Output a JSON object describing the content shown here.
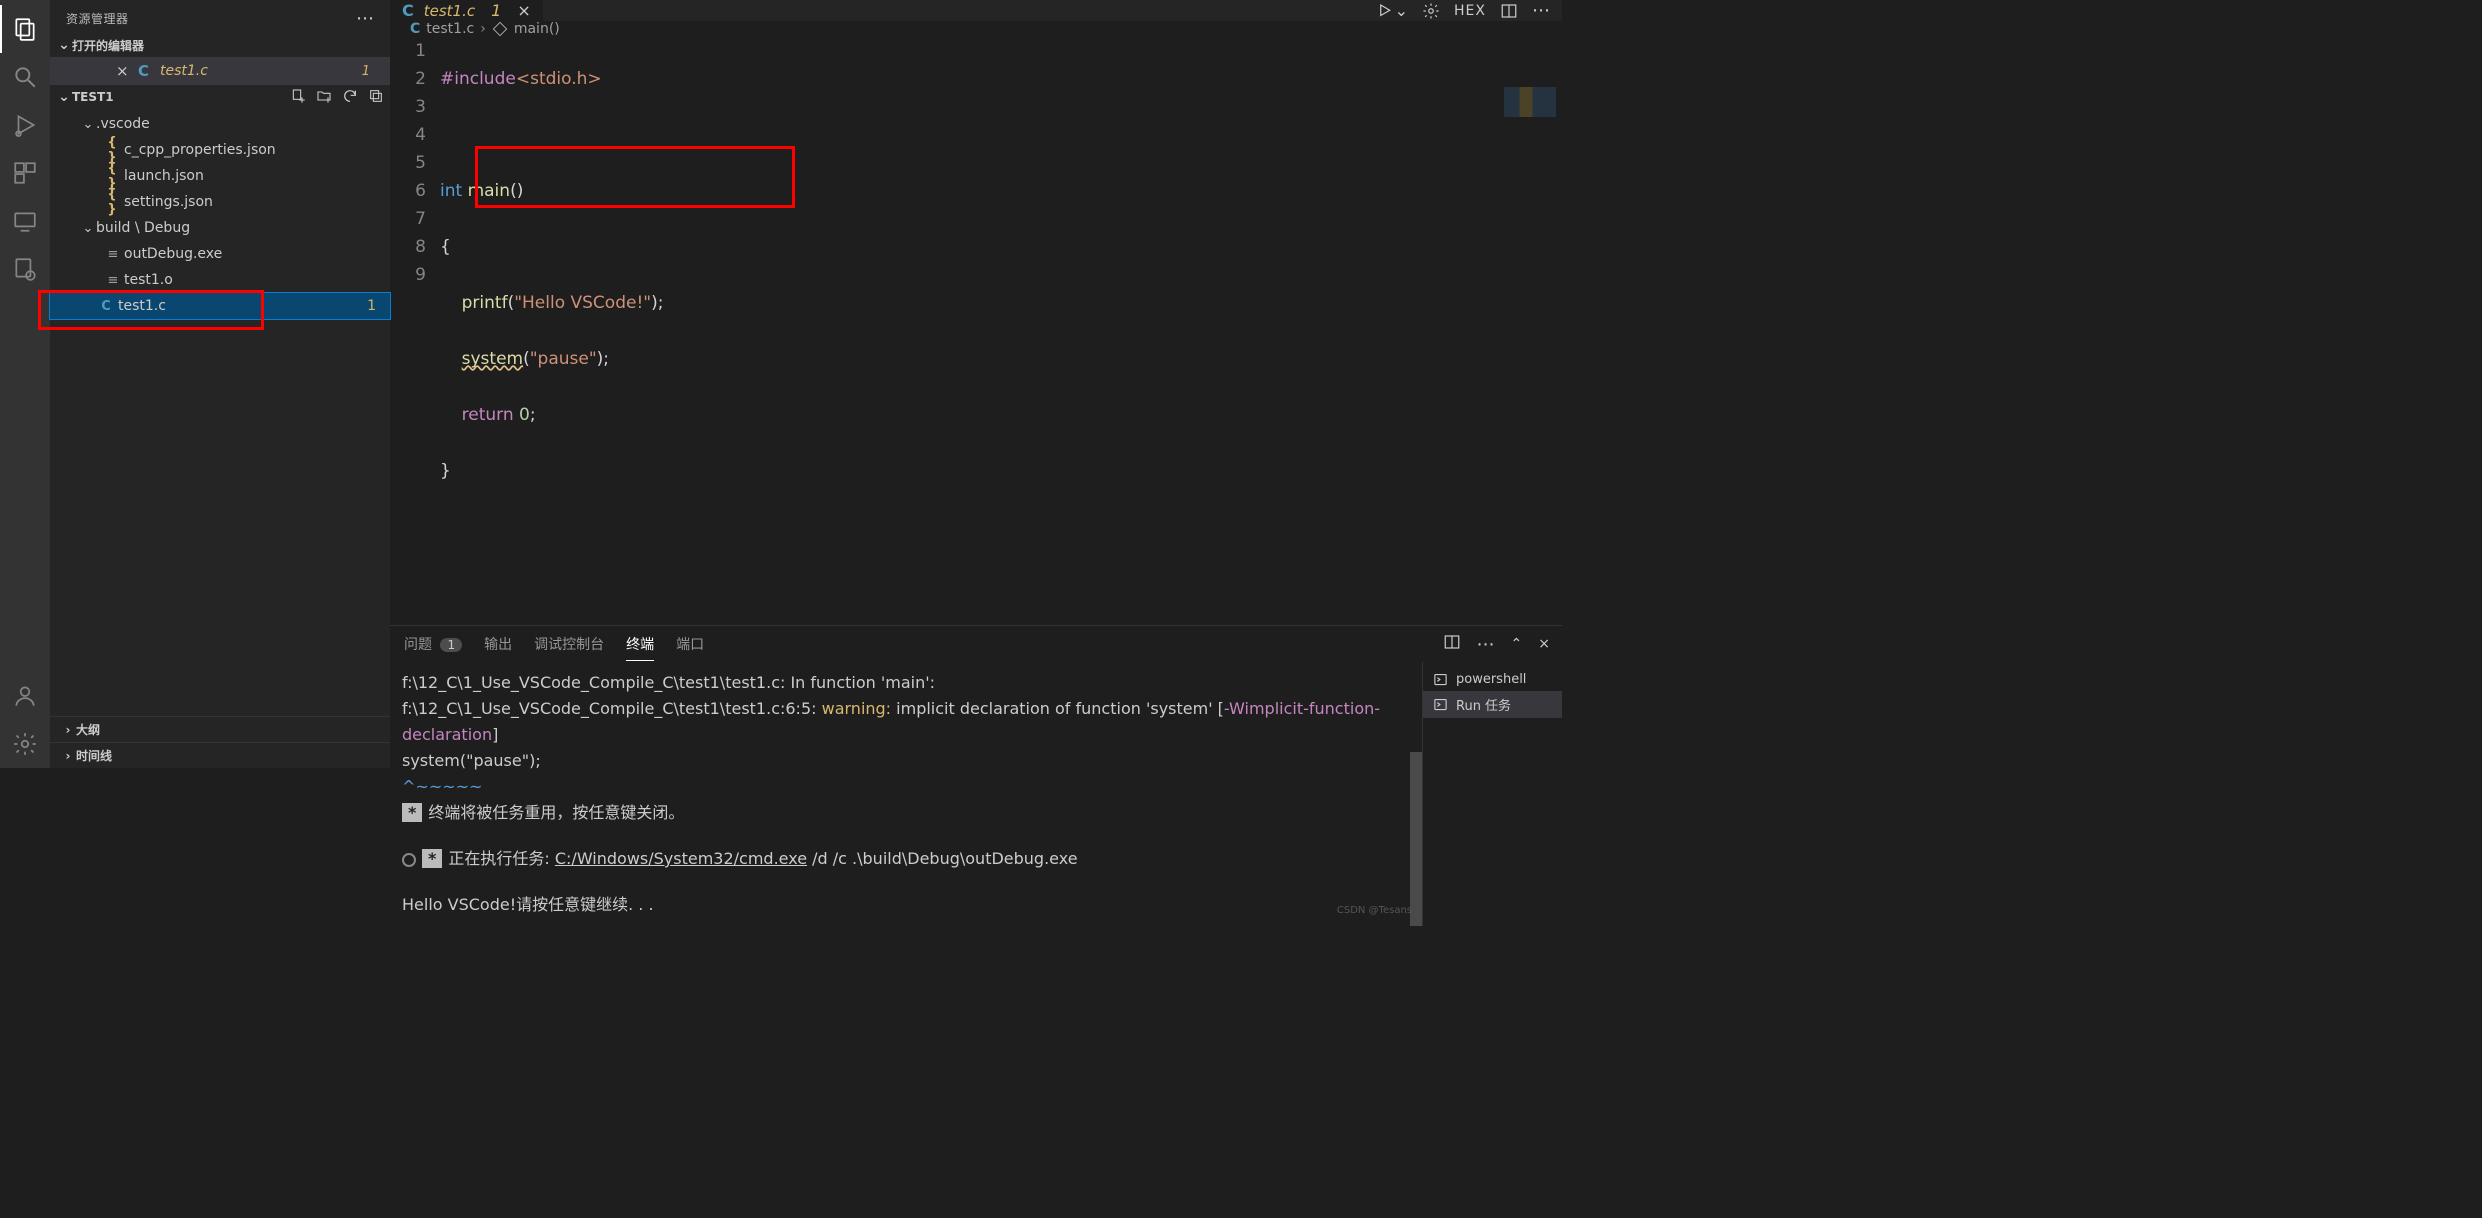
{
  "sidebar": {
    "title": "资源管理器",
    "openEditorsLabel": "打开的编辑器",
    "openEditor": {
      "file": "test1.c",
      "modifiedMark": "1"
    },
    "projectName": "TEST1",
    "tree": {
      "vscodeFolder": ".vscode",
      "files_vscode": [
        "c_cpp_properties.json",
        "launch.json",
        "settings.json"
      ],
      "buildFolder": "build \\ Debug",
      "files_build": [
        "outDebug.exe",
        "test1.o"
      ],
      "rootFile": "test1.c",
      "rootFileBadge": "1"
    },
    "footer": {
      "outline": "大纲",
      "timeline": "时间线"
    }
  },
  "editor": {
    "tab": {
      "name": "test1.c",
      "modified": "1"
    },
    "actions": {
      "hex": "HEX"
    },
    "breadcrumb": {
      "file": "test1.c",
      "symbol": "main()"
    },
    "code": {
      "lines": [
        "1",
        "2",
        "3",
        "4",
        "5",
        "6",
        "7",
        "8",
        "9"
      ],
      "l1_include": "#include",
      "l1_hdr": "<stdio.h>",
      "l3_int": "int",
      "l3_main": "main",
      "l3_paren": "()",
      "l4_brace": "{",
      "l5_printf": "printf",
      "l5_str": "\"Hello VSCode!\"",
      "l6_system": "system",
      "l6_str": "\"pause\"",
      "l7_return": "return",
      "l7_zero": "0",
      "l8_brace": "}"
    }
  },
  "panel": {
    "tabs": {
      "problems": "问题",
      "problemsCount": "1",
      "output": "输出",
      "debug": "调试控制台",
      "terminal": "终端",
      "ports": "端口"
    },
    "terminalSidebar": {
      "powershell": "powershell",
      "run": "Run 任务"
    },
    "terminal": {
      "line1": "f:\\12_C\\1_Use_VSCode_Compile_C\\test1\\test1.c: In function 'main':",
      "line2a": "f:\\12_C\\1_Use_VSCode_Compile_C\\test1\\test1.c:6:5: ",
      "line2warn": "warning: ",
      "line2b": "implicit declaration of function 'system' [",
      "line2flag": "-Wimplicit-function-declaration",
      "line2c": "]",
      "line3": "     system(\"pause\");",
      "line4": "     ^~~~~~",
      "reuseMsg": "终端将被任务重用，按任意键关闭。",
      "execMsg": "正在执行任务: ",
      "execCmd": "C:/Windows/System32/cmd.exe",
      "execArgs": " /d /c .\\build\\Debug\\outDebug.exe",
      "hello": "Hello VSCode!",
      "continue": "请按任意键继续. . ."
    }
  },
  "watermark": "CSDN @Tesans"
}
